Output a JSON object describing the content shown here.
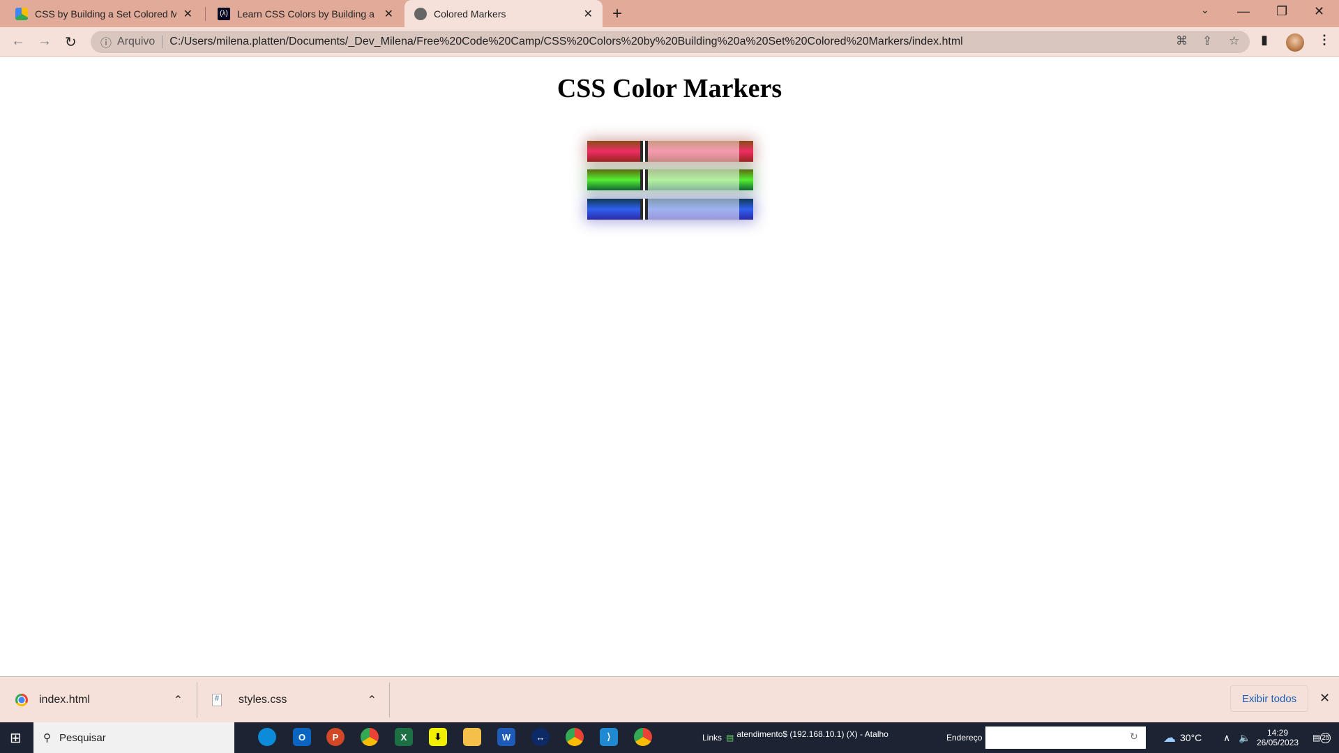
{
  "browser": {
    "tabs": [
      {
        "title": "CSS by Building a Set Colored Ma",
        "icon": "google-drive-icon",
        "active": false
      },
      {
        "title": "Learn CSS Colors by Building a Se",
        "icon": "freecodecamp-icon",
        "active": false
      },
      {
        "title": "Colored Markers",
        "icon": "globe-icon",
        "active": true
      }
    ],
    "new_tab": "+",
    "address_label": "Arquivo",
    "url": "C:/Users/milena.platten/Documents/_Dev_Milena/Free%20Code%20Camp/CSS%20Colors%20by%20Building%20a%20Set%20Colored%20Markers/index.html",
    "tabbar_color": "#e2aa99",
    "toolbar_color": "#f5e0da"
  },
  "page": {
    "title": "CSS Color Markers",
    "markers": [
      {
        "color": "red",
        "cap": "#ee2f64",
        "sleeve": "#f59ab0"
      },
      {
        "color": "green",
        "cap": "#55ee33",
        "sleeve": "#b3f0a0"
      },
      {
        "color": "blue",
        "cap": "#3060ee",
        "sleeve": "#9eb2f2"
      }
    ]
  },
  "downloads": {
    "items": [
      {
        "name": "index.html",
        "icon": "chrome-icon"
      },
      {
        "name": "styles.css",
        "icon": "css-file-icon"
      }
    ],
    "show_all": "Exibir todos"
  },
  "taskbar": {
    "search_placeholder": "Pesquisar",
    "links_label": "Links",
    "shortcut": "atendimento$ (192.168.10.1) (X) - Atalho",
    "address_label": "Endereço",
    "weather": "30°C",
    "time": "14:29",
    "date": "26/05/2023",
    "notifications": "25"
  }
}
